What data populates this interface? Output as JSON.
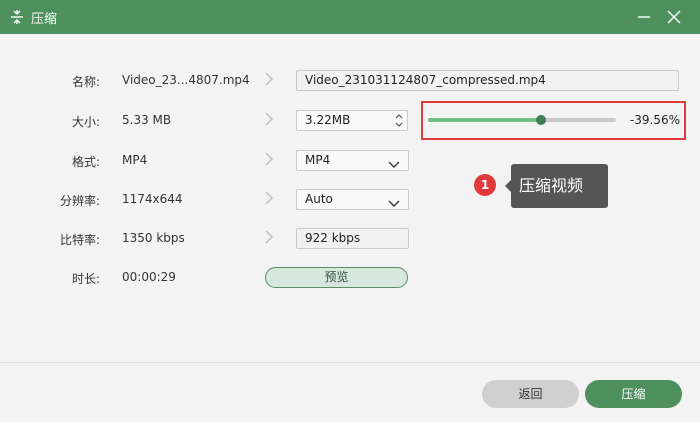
{
  "window": {
    "title": "压缩",
    "app_icon": "compress-icon",
    "minimize_icon": "minimize-icon",
    "close_icon": "close-icon"
  },
  "form": {
    "name": {
      "label": "名称:",
      "original": "Video_23...4807.mp4",
      "output": "Video_231031124807_compressed.mp4"
    },
    "size": {
      "label": "大小:",
      "original": "5.33 MB",
      "output": "3.22MB"
    },
    "format": {
      "label": "格式:",
      "original": "MP4",
      "output": "MP4"
    },
    "resolution": {
      "label": "分辨率:",
      "original": "1174x644",
      "output": "Auto"
    },
    "bitrate": {
      "label": "比特率:",
      "original": "1350 kbps",
      "output": "922 kbps"
    },
    "duration": {
      "label": "时长:",
      "original": "00:00:29"
    }
  },
  "preview_button": "预览",
  "compression": {
    "slider_level": 0.6,
    "percent_text": "-39.56%",
    "accent_color": "#e03a3a"
  },
  "callout": {
    "number": "1",
    "text": "压缩视频"
  },
  "footer": {
    "back_label": "返回",
    "compress_label": "压缩"
  },
  "colors": {
    "brand": "#4e8f5e",
    "slider_fill": "#6fbf80"
  }
}
